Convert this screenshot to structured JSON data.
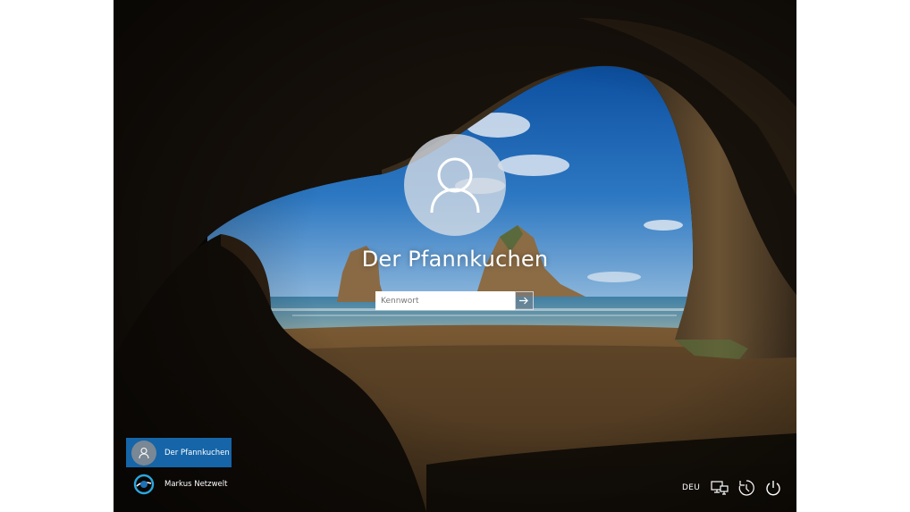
{
  "login": {
    "username": "Der Pfannkuchen",
    "password_placeholder": "Kennwort",
    "password_value": ""
  },
  "users": [
    {
      "name": "Der Pfannkuchen",
      "selected": true,
      "icon": "user-icon"
    },
    {
      "name": "Markus Netzwelt",
      "selected": false,
      "icon": "brand-logo-icon"
    }
  ],
  "tray": {
    "language": "DEU",
    "icons": [
      "network-icon",
      "ease-of-access-icon",
      "power-icon"
    ]
  },
  "colors": {
    "selected_tile": "#1565a8",
    "avatar_circle": "#d7dee6"
  }
}
